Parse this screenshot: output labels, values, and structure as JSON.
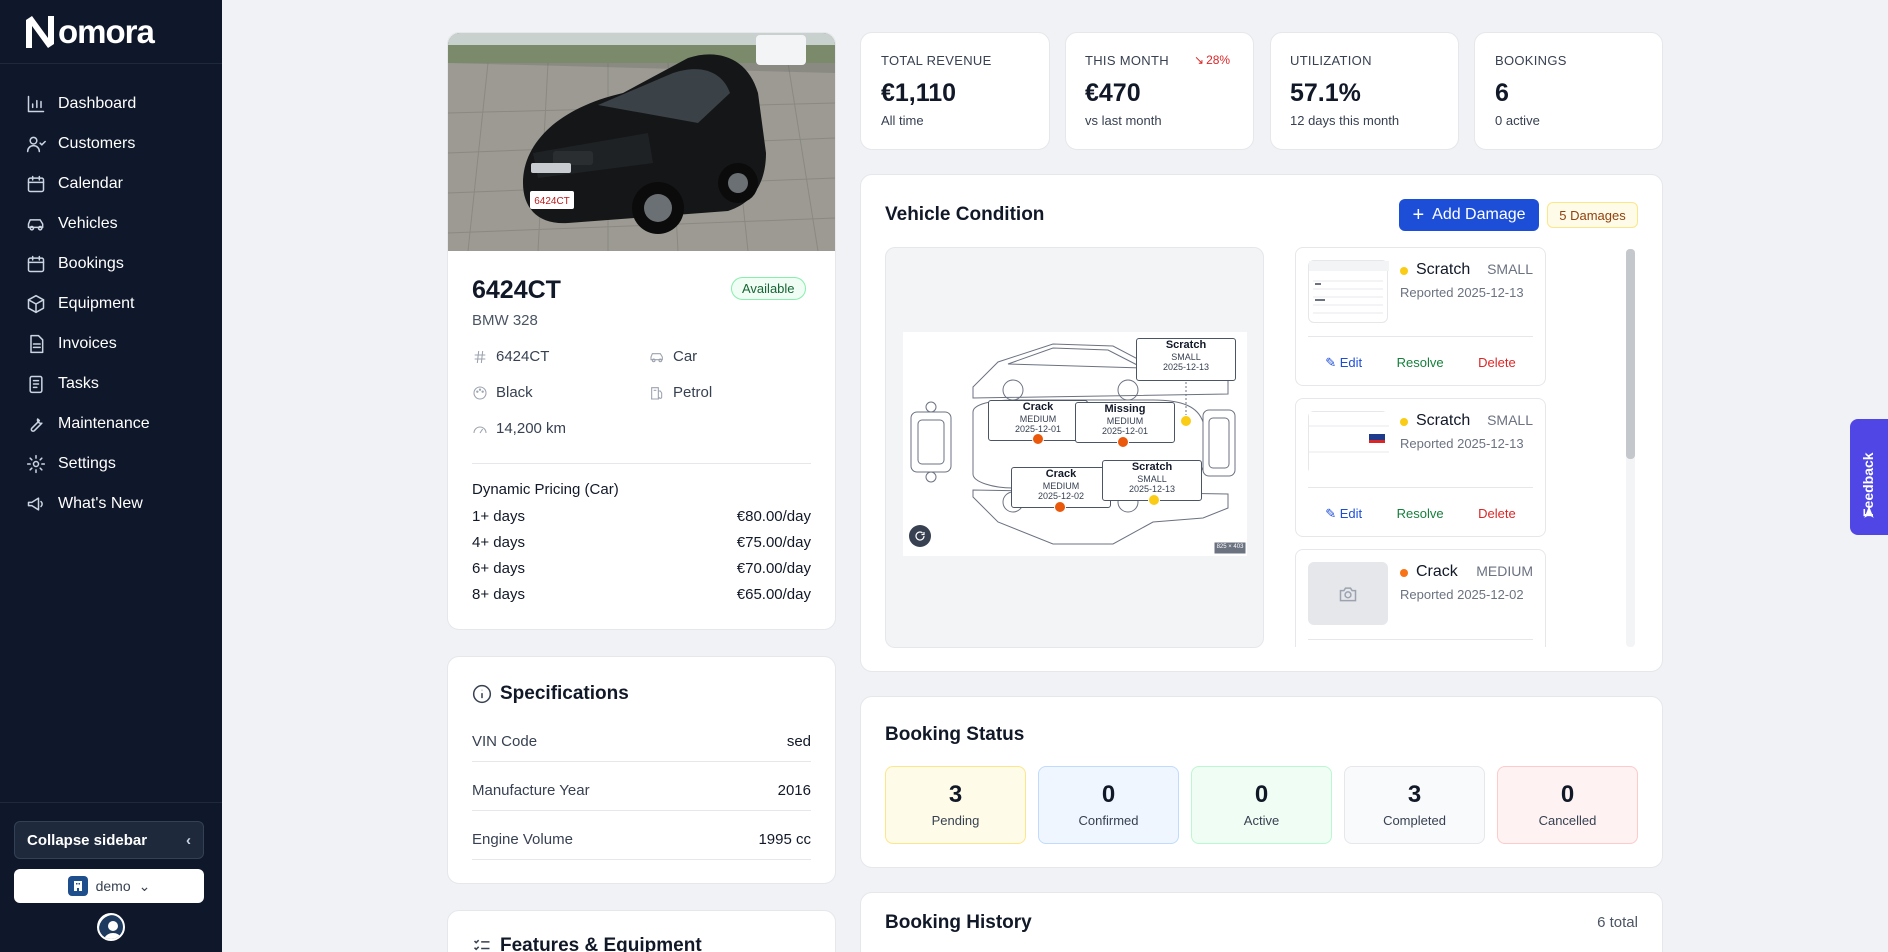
{
  "brand": {
    "name": "omora",
    "mark": "N"
  },
  "nav": [
    {
      "label": "Dashboard",
      "icon": "bar-chart-icon"
    },
    {
      "label": "Customers",
      "icon": "user-icon"
    },
    {
      "label": "Calendar",
      "icon": "calendar-icon"
    },
    {
      "label": "Vehicles",
      "icon": "car-icon"
    },
    {
      "label": "Bookings",
      "icon": "calendar-check-icon"
    },
    {
      "label": "Equipment",
      "icon": "box-icon"
    },
    {
      "label": "Invoices",
      "icon": "file-text-icon"
    },
    {
      "label": "Tasks",
      "icon": "clipboard-icon"
    },
    {
      "label": "Maintenance",
      "icon": "wrench-icon"
    },
    {
      "label": "Settings",
      "icon": "gear-icon"
    },
    {
      "label": "What's New",
      "icon": "megaphone-icon"
    }
  ],
  "sidebar_footer": {
    "collapse_label": "Collapse sidebar",
    "tenant": "demo"
  },
  "vehicle": {
    "plate": "6424CT",
    "model": "BMW 328",
    "status": "Available",
    "details": {
      "plate": "6424CT",
      "type": "Car",
      "color": "Black",
      "fuel": "Petrol",
      "mileage": "14,200 km"
    },
    "photo_plate_text": "6424CT"
  },
  "pricing": {
    "title": "Dynamic Pricing (Car)",
    "rows": [
      {
        "label": "1+ days",
        "price": "€80.00/day"
      },
      {
        "label": "4+ days",
        "price": "€75.00/day"
      },
      {
        "label": "6+ days",
        "price": "€70.00/day"
      },
      {
        "label": "8+ days",
        "price": "€65.00/day"
      }
    ]
  },
  "specifications": {
    "title": "Specifications",
    "rows": [
      {
        "label": "VIN Code",
        "value": "sed"
      },
      {
        "label": "Manufacture Year",
        "value": "2016"
      },
      {
        "label": "Engine Volume",
        "value": "1995 cc"
      }
    ]
  },
  "features": {
    "title": "Features & Equipment"
  },
  "stats": [
    {
      "label": "TOTAL REVENUE",
      "value": "€1,110",
      "sub": "All time",
      "delta": ""
    },
    {
      "label": "THIS MONTH",
      "value": "€470",
      "sub": "vs last month",
      "delta": "28%"
    },
    {
      "label": "UTILIZATION",
      "value": "57.1%",
      "sub": "12 days this month",
      "delta": ""
    },
    {
      "label": "BOOKINGS",
      "value": "6",
      "sub": "0 active",
      "delta": ""
    }
  ],
  "condition": {
    "title": "Vehicle Condition",
    "add_label": "Add Damage",
    "count_label": "5 Damages",
    "diagram_size_label": "825 × 403",
    "callouts": [
      {
        "type": "Scratch",
        "size": "SMALL",
        "date": "2025-12-13"
      },
      {
        "type": "Crack",
        "size": "MEDIUM",
        "date": "2025-12-01"
      },
      {
        "type": "Missing",
        "size": "MEDIUM",
        "date": "2025-12-01"
      },
      {
        "type": "Crack",
        "size": "MEDIUM",
        "date": "2025-12-02"
      },
      {
        "type": "Scratch",
        "size": "SMALL",
        "date": "2025-12-13"
      }
    ],
    "damages": [
      {
        "type": "Scratch",
        "size": "SMALL",
        "reported": "Reported 2025-12-13",
        "color": "#facc15"
      },
      {
        "type": "Scratch",
        "size": "SMALL",
        "reported": "Reported 2025-12-13",
        "color": "#facc15"
      },
      {
        "type": "Crack",
        "size": "MEDIUM",
        "reported": "Reported 2025-12-02",
        "color": "#f97316"
      }
    ],
    "actions": {
      "edit": "Edit",
      "resolve": "Resolve",
      "delete": "Delete"
    }
  },
  "booking_status": {
    "title": "Booking Status",
    "items": [
      {
        "count": "3",
        "label": "Pending"
      },
      {
        "count": "0",
        "label": "Confirmed"
      },
      {
        "count": "0",
        "label": "Active"
      },
      {
        "count": "3",
        "label": "Completed"
      },
      {
        "count": "0",
        "label": "Cancelled"
      }
    ]
  },
  "booking_history": {
    "title": "Booking History",
    "total": "6 total"
  },
  "feedback_label": "Feedback",
  "colors": {
    "sidebar": "#0f172a",
    "primary": "#1d4ed8",
    "accent_feedback": "#4f46e5",
    "danger": "#dc2626",
    "success": "#15803d"
  }
}
